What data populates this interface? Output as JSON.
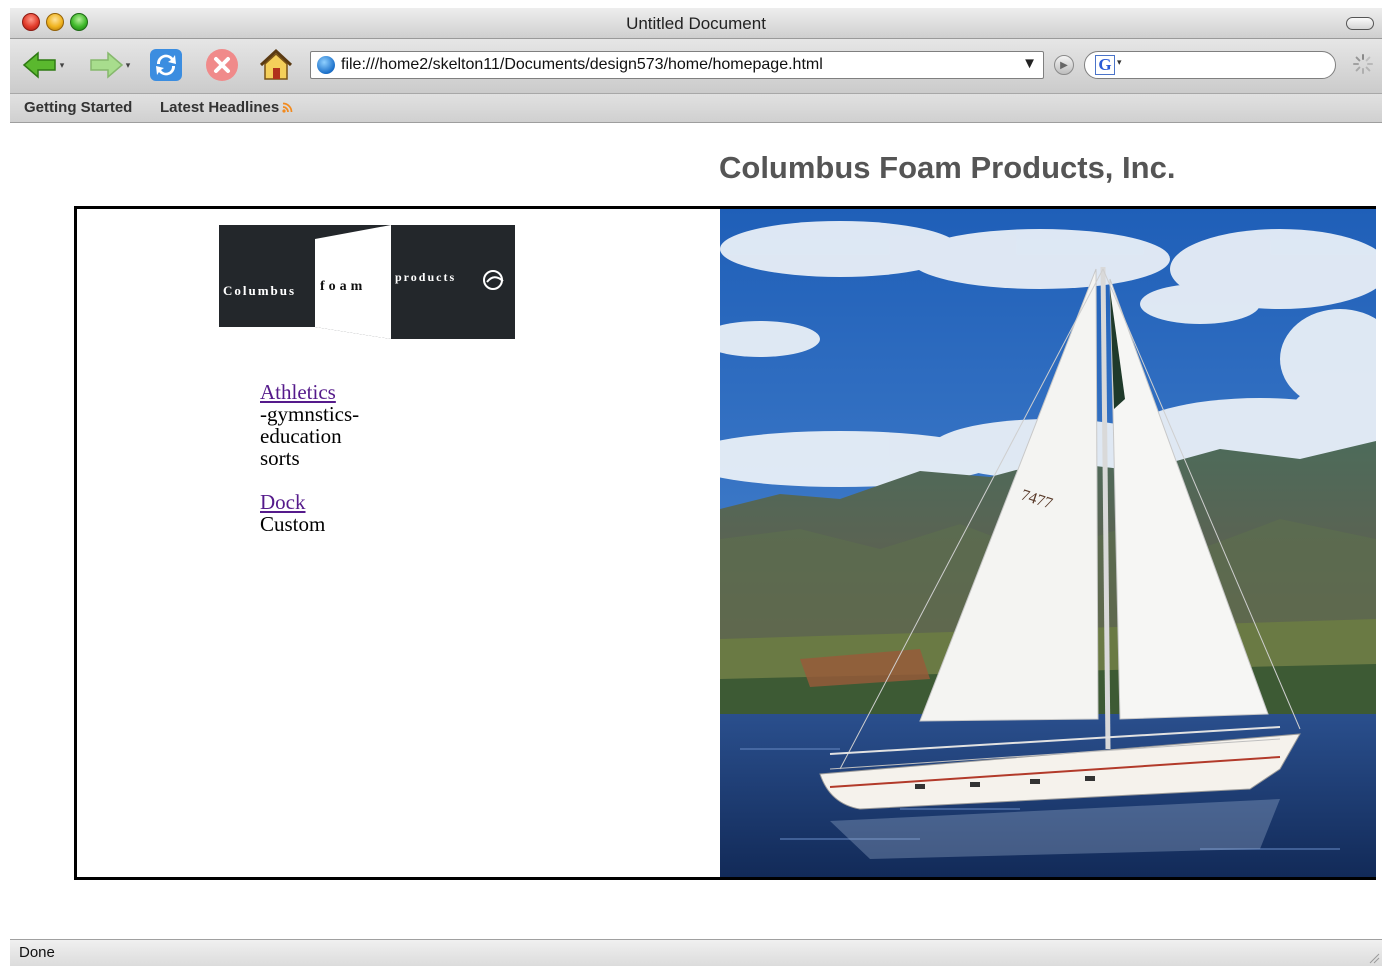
{
  "window": {
    "title": "Untitled Document"
  },
  "toolbar": {
    "url": "file:///home2/skelton11/Documents/design573/home/homepage.html",
    "search_value": ""
  },
  "bookmarks": [
    {
      "label": "Getting Started"
    },
    {
      "label": "Latest Headlines"
    }
  ],
  "page": {
    "heading": "Columbus Foam Products, Inc.",
    "logo_text": {
      "part1": "Columbus",
      "part2": "foam",
      "part3": "products"
    },
    "nav": [
      {
        "link": "Athletics",
        "lines": [
          "-gymnstics-",
          "education",
          "sorts"
        ]
      },
      {
        "link": "Dock",
        "lines": [
          "Custom"
        ]
      }
    ],
    "photo_sail_number": "7477"
  },
  "status": {
    "text": "Done"
  },
  "colors": {
    "link_visited": "#551a8b",
    "heading": "#555555",
    "sky": "#2f6fc4",
    "sea": "#1f3f7a"
  }
}
